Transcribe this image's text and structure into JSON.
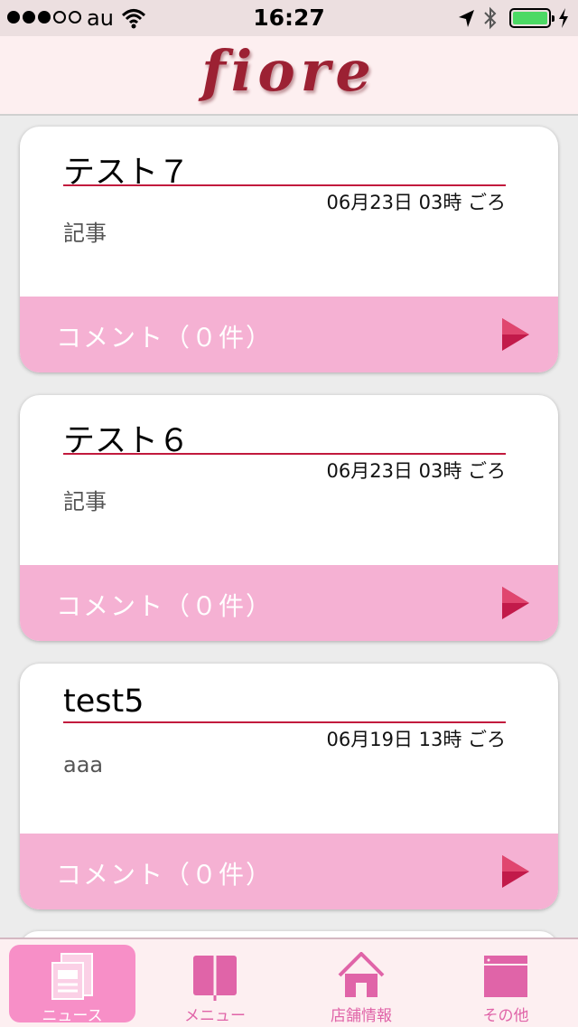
{
  "status_bar": {
    "carrier": "au",
    "time": "16:27"
  },
  "header": {
    "logo_text": "fiore"
  },
  "posts": [
    {
      "title": "テスト７",
      "date": "06月23日 03時 ごろ",
      "body": "記事",
      "comment_label": "コメント（０件）"
    },
    {
      "title": "テスト６",
      "date": "06月23日 03時 ごろ",
      "body": "記事",
      "comment_label": "コメント（０件）"
    },
    {
      "title": "test5",
      "date": "06月19日 13時 ごろ",
      "body": "aaa",
      "comment_label": "コメント（０件）"
    }
  ],
  "tabs": [
    {
      "label": "ニュース",
      "icon": "news-icon",
      "active": true
    },
    {
      "label": "メニュー",
      "icon": "menu-book-icon",
      "active": false
    },
    {
      "label": "店舗情報",
      "icon": "house-icon",
      "active": false
    },
    {
      "label": "その他",
      "icon": "window-icon",
      "active": false
    }
  ],
  "colors": {
    "accent": "#c21a3d",
    "comment_bar": "#f5b1d3",
    "tab_active": "#f78fc7",
    "tab_icon": "#e064a8",
    "battery": "#4cd964"
  }
}
